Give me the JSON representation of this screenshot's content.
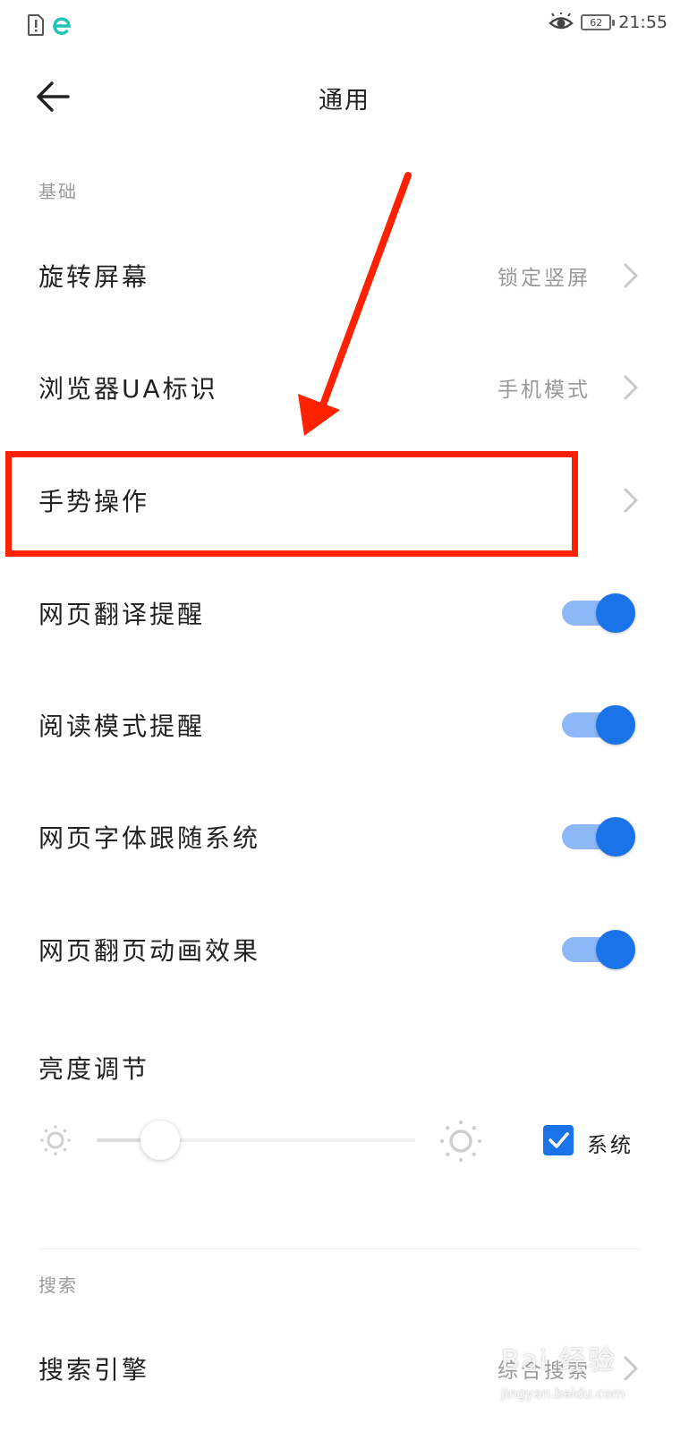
{
  "status_bar": {
    "time": "21:55",
    "battery": "62",
    "left_icons": [
      "sim-alert-icon",
      "browser-e-icon"
    ],
    "right_icons": [
      "eye-comfort-icon",
      "battery-icon"
    ]
  },
  "header": {
    "title": "通用",
    "back_icon": "arrow-left-icon"
  },
  "sections": {
    "basic": "基础",
    "search": "搜索"
  },
  "rows": {
    "rotate": {
      "label": "旋转屏幕",
      "value": "锁定竖屏"
    },
    "ua": {
      "label": "浏览器UA标识",
      "value": "手机模式"
    },
    "gesture": {
      "label": "手势操作"
    },
    "translate": {
      "label": "网页翻译提醒",
      "on": true
    },
    "reading": {
      "label": "阅读模式提醒",
      "on": true
    },
    "font": {
      "label": "网页字体跟随系统",
      "on": true
    },
    "animation": {
      "label": "网页翻页动画效果",
      "on": true
    },
    "engine": {
      "label": "搜索引擎",
      "value": "综合搜索"
    }
  },
  "brightness": {
    "label": "亮度调节",
    "level": 0.2,
    "system_label": "系统",
    "system_checked": true
  },
  "colors": {
    "accent": "#1a73e8",
    "toggle_track": "#8cb8f8",
    "annotation": "#ff2200"
  },
  "watermark": {
    "text": "Bai 经验",
    "sub": "jingyan.baidu.com"
  }
}
